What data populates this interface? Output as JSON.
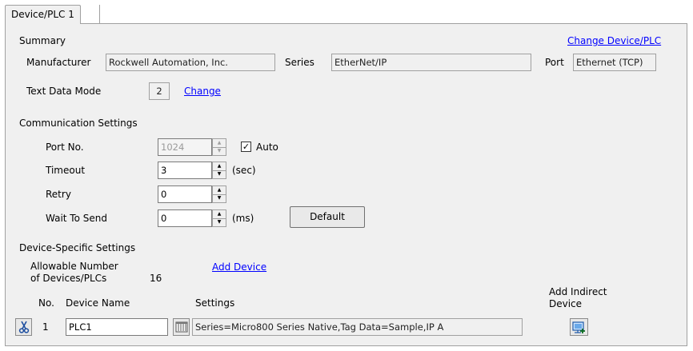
{
  "tab": {
    "label": "Device/PLC 1"
  },
  "summary": {
    "heading": "Summary",
    "change_link": "Change Device/PLC",
    "manufacturer_label": "Manufacturer",
    "manufacturer_value": "Rockwell Automation, Inc.",
    "series_label": "Series",
    "series_value": "EtherNet/IP",
    "port_label": "Port",
    "port_value": "Ethernet (TCP)",
    "text_mode_label": "Text Data Mode",
    "text_mode_value": "2",
    "text_mode_change": "Change"
  },
  "comm": {
    "heading": "Communication Settings",
    "port_no_label": "Port No.",
    "port_no_value": "1024",
    "auto_label": "Auto",
    "auto_checked": true,
    "timeout_label": "Timeout",
    "timeout_value": "3",
    "timeout_unit": "(sec)",
    "retry_label": "Retry",
    "retry_value": "0",
    "wait_label": "Wait To Send",
    "wait_value": "0",
    "wait_unit": "(ms)",
    "default_button": "Default"
  },
  "device": {
    "heading": "Device-Specific Settings",
    "allowable_line1": "Allowable Number",
    "allowable_line2": "of Devices/PLCs",
    "allowable_value": "16",
    "add_device_link": "Add Device",
    "col_no": "No.",
    "col_name": "Device Name",
    "col_settings": "Settings",
    "add_indirect_line1": "Add Indirect",
    "add_indirect_line2": "Device",
    "rows": [
      {
        "no": "1",
        "name": "PLC1",
        "settings": "Series=Micro800 Series Native,Tag Data=Sample,IP A"
      }
    ]
  },
  "icons": {
    "delete_row": "scissors-icon",
    "settings_row": "settings-grid-icon",
    "add_indirect": "add-indirect-device-icon"
  }
}
